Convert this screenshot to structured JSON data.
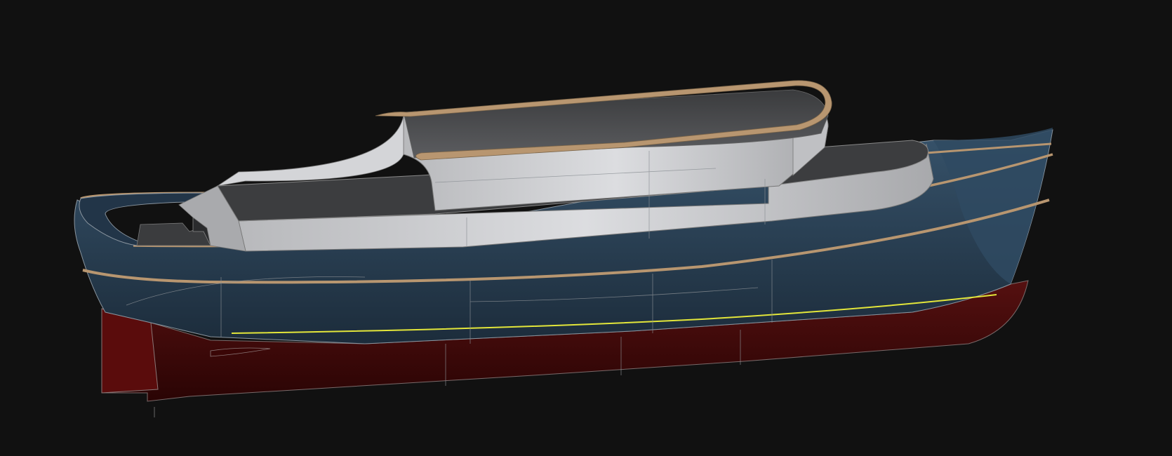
{
  "scene": {
    "subject": "boat-hull-3d-render",
    "colors": {
      "background": "#111111",
      "hull_topsides": "#2b4257",
      "hull_topsides_dark": "#1e2f3f",
      "hull_bottom": "#4a0808",
      "hull_bottom_dark": "#2a0404",
      "superstructure": "#c9cacc",
      "superstructure_shade": "#9d9ea1",
      "roof_underside": "#4a4b4d",
      "trim": "#b89670",
      "waterline": "#e3e63a",
      "edge_lines": "#8a8f94"
    }
  }
}
